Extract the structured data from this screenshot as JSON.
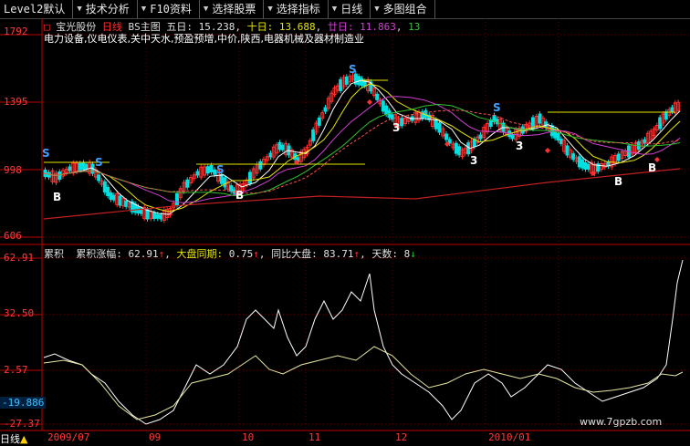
{
  "toolbar": {
    "items": [
      "Level2默认",
      "技术分析",
      "F10资料",
      "选择股票",
      "选择指标",
      "日线",
      "多图组合"
    ]
  },
  "main": {
    "stock_name": "宝光股份",
    "period": "日线",
    "main_indicator": "BS主图",
    "ma5_label": "五日:",
    "ma5_value": "15.238",
    "ma10_label": "十日:",
    "ma10_value": "13.688",
    "ma20_label": "廿日:",
    "ma20_value": "11.863",
    "extra_value": "13",
    "description": "电力设备,仪电仪表,关中天水,预盈预增,中价,陕西,电器机械及器材制造业",
    "y_labels": [
      "1792",
      "1395",
      "998",
      "606"
    ],
    "signal_b": "B",
    "signal_s": "S",
    "signal_3": "3"
  },
  "indicator": {
    "name": "累积",
    "rise_label": "累积涨幅:",
    "rise_value": "62.91",
    "market_label": "大盘同期:",
    "market_value": "0.75",
    "vs_label": "同比大盘:",
    "vs_value": "83.71",
    "days_label": "天数:",
    "days_value": "8",
    "y_labels": [
      "62.91",
      "32.50",
      "2.57",
      "-19.886",
      "-27.37"
    ]
  },
  "x_labels": [
    "2009/07",
    "09",
    "10",
    "11",
    "12",
    "2010/01"
  ],
  "period_label": "日线",
  "watermark": "www.7gpzb.com",
  "colors": {
    "up": "#ff3030",
    "down": "#00e0e0",
    "axis": "#c00000",
    "ma5": "#ffffff",
    "ma10": "#e6e600",
    "ma20": "#d040d0"
  }
}
